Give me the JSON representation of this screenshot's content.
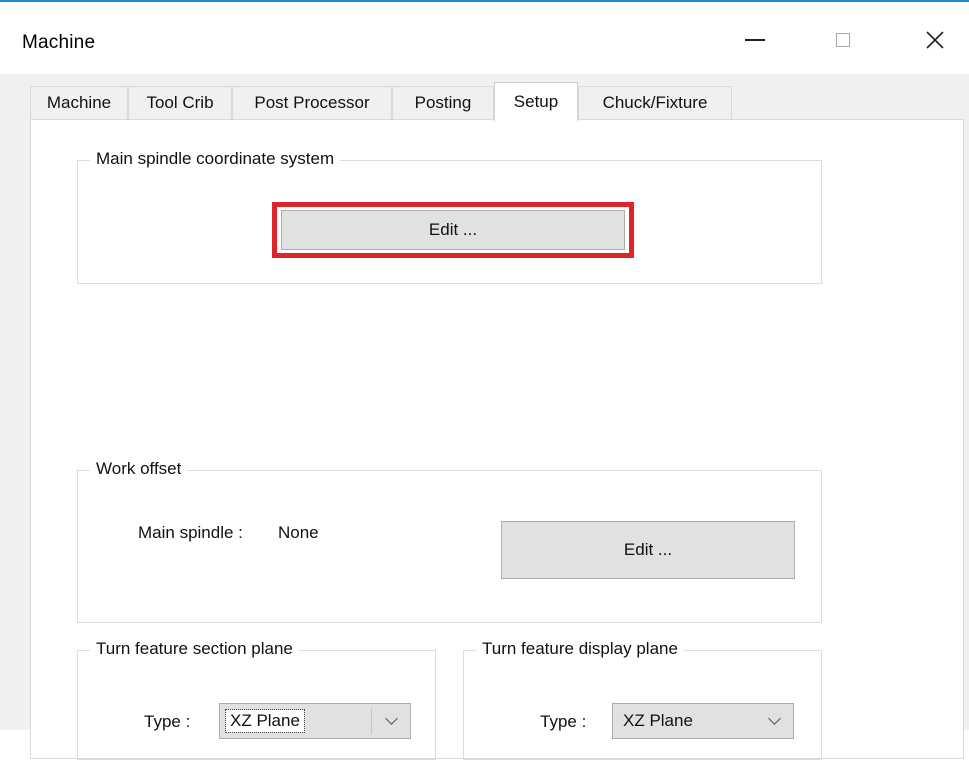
{
  "window": {
    "title": "Machine",
    "controls": {
      "minimize": "minimize-icon",
      "maximize": "maximize-icon",
      "close": "close-icon"
    }
  },
  "tabs": [
    {
      "label": "Machine"
    },
    {
      "label": "Tool Crib"
    },
    {
      "label": "Post Processor"
    },
    {
      "label": "Posting"
    },
    {
      "label": "Setup",
      "active": true
    },
    {
      "label": "Chuck/Fixture"
    }
  ],
  "main_spindle_group": {
    "legend": "Main spindle coordinate system",
    "edit_label": "Edit ...",
    "highlight_color": "#e0242c"
  },
  "work_offset_group": {
    "legend": "Work offset",
    "main_spindle_label": "Main spindle :",
    "main_spindle_value": "None",
    "edit_label": "Edit ..."
  },
  "turn_section_group": {
    "legend": "Turn feature section plane",
    "type_label": "Type :",
    "type_value": "XZ Plane"
  },
  "turn_display_group": {
    "legend": "Turn feature display plane",
    "type_label": "Type :",
    "type_value": "XZ Plane"
  }
}
